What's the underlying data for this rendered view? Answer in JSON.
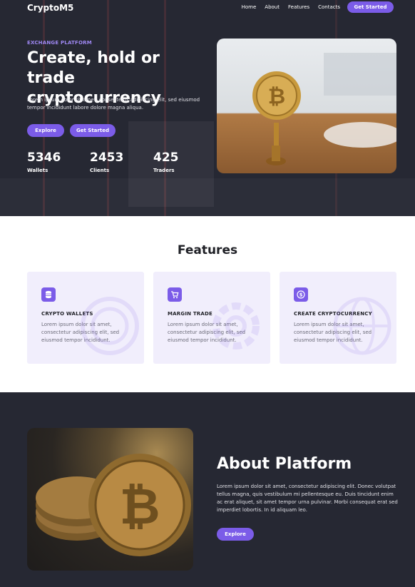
{
  "nav": {
    "logo": "CryptoM5",
    "links": [
      "Home",
      "About",
      "Features",
      "Contacts"
    ],
    "cta": "Get Started"
  },
  "hero": {
    "eyebrow": "EXCHANGE PLATFORM",
    "title": "Create, hold or trade cryptocurrency",
    "description": "Lorem ipsum dolor sit amet, consectetur adipiscing elit, sed eiusmod tempor incididunt labore dolore magna aliqua.",
    "buttons": {
      "explore": "Explore",
      "get_started": "Get Started"
    },
    "stats": [
      {
        "value": "5346",
        "label": "Wallets"
      },
      {
        "value": "2453",
        "label": "Clients"
      },
      {
        "value": "425",
        "label": "Traders"
      }
    ]
  },
  "features": {
    "title": "Features",
    "cards": [
      {
        "icon": "database-icon",
        "title": "CRYPTO WALLETS",
        "description": "Lorem ipsum dolor sit amet, consectetur adipiscing elit, sed eiusmod tempor incididunt."
      },
      {
        "icon": "cart-icon",
        "title": "MARGIN TRADE",
        "description": "Lorem ipsum dolor sit amet, consectetur adipiscing elit, sed eiusmod tempor incididunt."
      },
      {
        "icon": "dollar-coin-icon",
        "title": "CREATE CRYPTOCURRENCY",
        "description": "Lorem ipsum dolor sit amet, consectetur adipiscing elit, sed eiusmod tempor incididunt."
      }
    ]
  },
  "about": {
    "title": "About Platform",
    "description": "Lorem ipsum dolor sit amet, consectetur adipiscing elit. Donec volutpat tellus magna, quis vestibulum mi pellentesque eu. Duis tincidunt enim ac erat aliquet, sit amet tempor urna pulvinar. Morbi consequat erat sed imperdiet lobortis. In id aliquam leo.",
    "button": "Explore"
  },
  "colors": {
    "accent": "#7b5ce8",
    "dark_bg": "#262833",
    "card_bg": "#f1eefc"
  }
}
